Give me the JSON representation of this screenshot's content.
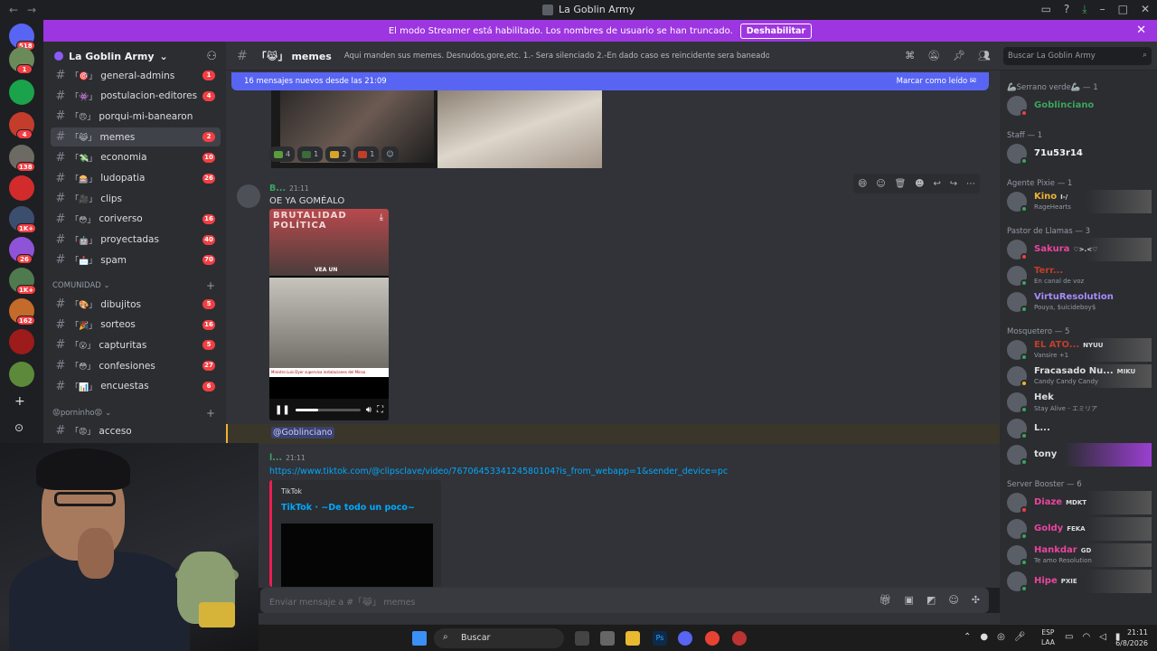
{
  "window": {
    "title": "La Goblin Army"
  },
  "banner": {
    "text": "El modo Streamer está habilitado. Los nombres de usuario se han truncado.",
    "button": "Deshabilitar"
  },
  "guilds": [
    {
      "badge": "518",
      "color": "#5865f2"
    },
    {
      "badge": "1",
      "color": "#6b8a5a"
    },
    {
      "badge": "",
      "color": "#1aa34a"
    },
    {
      "badge": "4",
      "color": "#c43c2c"
    },
    {
      "badge": "138",
      "color": "#6d6a63"
    },
    {
      "badge": "",
      "color": "#d12b2b"
    },
    {
      "badge": "1K+",
      "color": "#3c4e6e"
    },
    {
      "badge": "26",
      "color": "#8f53d7"
    },
    {
      "badge": "1K+",
      "color": "#4e7a4e"
    },
    {
      "badge": "162",
      "color": "#c46a2a"
    },
    {
      "badge": "",
      "color": "#9d1b1b"
    },
    {
      "badge": "",
      "color": "#5c8a3a"
    }
  ],
  "server": {
    "name": "La Goblin Army"
  },
  "channels": [
    {
      "name": "general-admins",
      "prefix": "「🎯」",
      "count": "1"
    },
    {
      "name": "postulacion-editores",
      "prefix": "「👾」",
      "count": "4"
    },
    {
      "name": "porqui-mi-banearon",
      "prefix": "「😠」",
      "count": ""
    },
    {
      "name": "memes",
      "prefix": "「😹」",
      "count": "2"
    },
    {
      "name": "economia",
      "prefix": "「💸」",
      "count": "10"
    },
    {
      "name": "ludopatia",
      "prefix": "「🎰」",
      "count": "26"
    },
    {
      "name": "clips",
      "prefix": "「🎥」",
      "count": ""
    },
    {
      "name": "coriverso",
      "prefix": "「😳」",
      "count": "16"
    },
    {
      "name": "proyectadas",
      "prefix": "「🤖」",
      "count": "40"
    },
    {
      "name": "spam",
      "prefix": "「📩」",
      "count": "70"
    }
  ],
  "category2": {
    "name": "COMUNIDAD"
  },
  "channels2": [
    {
      "name": "dibujitos",
      "prefix": "「🎨」",
      "count": "5"
    },
    {
      "name": "sorteos",
      "prefix": "「🎉」",
      "count": "16"
    },
    {
      "name": "capturitas",
      "prefix": "「😮」",
      "count": "5"
    },
    {
      "name": "confesiones",
      "prefix": "「😳」",
      "count": "27"
    },
    {
      "name": "encuestas",
      "prefix": "「📊」",
      "count": "6"
    }
  ],
  "category3": {
    "name": "😡porninho😡"
  },
  "channels3": [
    {
      "name": "acceso",
      "prefix": "「😡」",
      "count": ""
    }
  ],
  "channel_header": {
    "name": "memes",
    "prefix": "「😹」",
    "topic": "Aqui manden sus memes. Desnudos,gore,etc. 1.- Sera silenciado 2.-En dado caso es reincidente sera baneado"
  },
  "search": {
    "placeholder": "Buscar La Goblin Army"
  },
  "new_messages": {
    "text": "16 mensajes nuevos desde las 21:09",
    "mark": "Marcar como leído"
  },
  "reactions": [
    {
      "count": "4",
      "color": "#5a9c3a"
    },
    {
      "count": "1",
      "color": "#3c6b3a"
    },
    {
      "count": "2",
      "color": "#d6a42a"
    },
    {
      "count": "1",
      "color": "#c43c2c"
    }
  ],
  "message1": {
    "author": "B...",
    "time": "21:11",
    "text": "OE YA GOMÉALO",
    "video_caption": "BRUTALIDAD POLÍTICA",
    "video_sub": "VEA UN",
    "video_ticker": "Ministro Luis Dyer supervisa instalaciones del Minsa",
    "progress": 0.35
  },
  "mention": {
    "text": "@Goblinciano"
  },
  "message2": {
    "author": "l...",
    "time": "21:11",
    "link": "https://www.tiktok.com/@clipsclave/video/7670645334124580104?is_from_webapp=1&sender_device=pc",
    "embed_provider": "TikTok",
    "embed_title": "TikTok · ~De todo un poco~"
  },
  "input": {
    "placeholder": "Enviar mensaje a #「😹」 memes"
  },
  "members": {
    "sections": [
      {
        "title": "🦾Serrano verde🦾 — 1",
        "items": [
          {
            "name": "Goblinciano",
            "color": "#3ba55d",
            "sub": "",
            "tag": "",
            "dot": "#f23f43"
          }
        ]
      },
      {
        "title": "Staff — 1",
        "items": [
          {
            "name": "71u53r14",
            "color": "#f2f3f5",
            "sub": "",
            "tag": "",
            "dot": "#3ba55d"
          }
        ]
      },
      {
        "title": "Agente Pixie — 1",
        "items": [
          {
            "name": "Kino",
            "color": "#f0b232",
            "sub": "RageHearts",
            "tag": "I-/",
            "dot": "#3ba55d"
          }
        ]
      },
      {
        "title": "Pastor de Llamas — 3",
        "items": [
          {
            "name": "Sakura",
            "color": "#eb459e",
            "sub": "",
            "tag": "♡>.<♡",
            "dot": "#f23f43"
          },
          {
            "name": "Terr...",
            "color": "#c43c2c",
            "sub": "En canal de voz",
            "tag": "",
            "dot": "#3ba55d"
          },
          {
            "name": "VirtuResolution",
            "color": "#a78bfa",
            "sub": "Pouya, $uicideboy$",
            "tag": "",
            "dot": "#3ba55d"
          }
        ]
      },
      {
        "title": "Mosquetero — 5",
        "items": [
          {
            "name": "EL ATO...",
            "color": "#c43c2c",
            "sub": "Vansire +1",
            "tag": "NYUU",
            "dot": "#3ba55d"
          },
          {
            "name": "Fracasado Nu...",
            "color": "#dbdee1",
            "sub": "Candy Candy Candy",
            "tag": "MIKU",
            "dot": "#f0b232"
          },
          {
            "name": "Hek",
            "color": "#dbdee1",
            "sub": "Stay Alive - エミリア",
            "tag": "",
            "dot": "#3ba55d"
          },
          {
            "name": "L...",
            "color": "#dbdee1",
            "sub": "",
            "tag": "",
            "dot": "#3ba55d"
          },
          {
            "name": "tony",
            "color": "#dbdee1",
            "sub": "",
            "tag": "",
            "dot": "#3ba55d"
          }
        ]
      },
      {
        "title": "Server Booster — 6",
        "items": [
          {
            "name": "Diaze",
            "color": "#eb459e",
            "sub": "",
            "tag": "MDKT",
            "dot": "#f23f43"
          },
          {
            "name": "Goldy",
            "color": "#eb459e",
            "sub": "",
            "tag": "FEKA",
            "dot": "#3ba55d"
          },
          {
            "name": "Hankdar",
            "color": "#eb459e",
            "sub": "Te amo Resolution",
            "tag": "GD",
            "dot": "#3ba55d"
          },
          {
            "name": "Hipe",
            "color": "#eb459e",
            "sub": "",
            "tag": "PXIE",
            "dot": "#3ba55d"
          }
        ]
      }
    ]
  },
  "taskbar": {
    "search": "Buscar",
    "lang1": "ESP",
    "lang2": "LAA",
    "time": "21:11",
    "date": "6/8/2026"
  }
}
